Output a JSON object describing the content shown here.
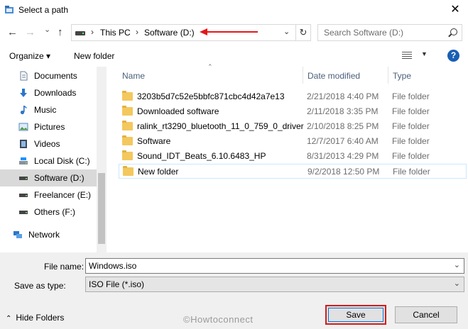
{
  "title": "Select a path",
  "nav": {
    "back": "←",
    "forward": "→",
    "recent": "⌄",
    "up": "↑",
    "address": [
      "This PC",
      "Software (D:)"
    ],
    "crumb_sep": "›",
    "refresh": "↻",
    "search_placeholder": "Search Software (D:)"
  },
  "toolbar": {
    "organize": "Organize ▾",
    "new_folder": "New folder",
    "help": "?"
  },
  "sidebar": {
    "items": [
      {
        "label": "Documents",
        "icon": "documents-icon"
      },
      {
        "label": "Downloads",
        "icon": "downloads-icon"
      },
      {
        "label": "Music",
        "icon": "music-icon"
      },
      {
        "label": "Pictures",
        "icon": "pictures-icon"
      },
      {
        "label": "Videos",
        "icon": "videos-icon"
      },
      {
        "label": "Local Disk (C:)",
        "icon": "local-disk-icon"
      },
      {
        "label": "Software (D:)",
        "icon": "drive-icon"
      },
      {
        "label": "Freelancer (E:)",
        "icon": "drive-icon"
      },
      {
        "label": "Others (F:)",
        "icon": "drive-icon"
      },
      {
        "label": "Network",
        "icon": "network-icon"
      }
    ],
    "selected_index": 6
  },
  "columns": {
    "name": "Name",
    "date": "Date modified",
    "type": "Type"
  },
  "files": [
    {
      "name": "3203b5d7c52e5bbfc871cbc4d42a7e13",
      "date": "2/21/2018 4:40 PM",
      "type": "File folder"
    },
    {
      "name": "Downloaded software",
      "date": "2/11/2018 3:35 PM",
      "type": "File folder"
    },
    {
      "name": "ralink_rt3290_bluetooth_11_0_759_0_driver",
      "date": "2/10/2018 8:25 PM",
      "type": "File folder"
    },
    {
      "name": "Software",
      "date": "12/7/2017 6:40 AM",
      "type": "File folder"
    },
    {
      "name": "Sound_IDT_Beats_6.10.6483_HP",
      "date": "8/31/2013 4:29 PM",
      "type": "File folder"
    },
    {
      "name": "New folder",
      "date": "9/2/2018 12:50 PM",
      "type": "File folder"
    }
  ],
  "form": {
    "file_name_label": "File name:",
    "file_name_value": "Windows.iso",
    "save_type_label": "Save as type:",
    "save_type_value": "ISO File (*.iso)"
  },
  "footer": {
    "hide_folders": "Hide Folders",
    "watermark": "©Howtoconnect",
    "save": "Save",
    "cancel": "Cancel"
  },
  "colors": {
    "annotation": "#e31818",
    "selection": "#cce8ff",
    "help": "#1a5fb4"
  }
}
